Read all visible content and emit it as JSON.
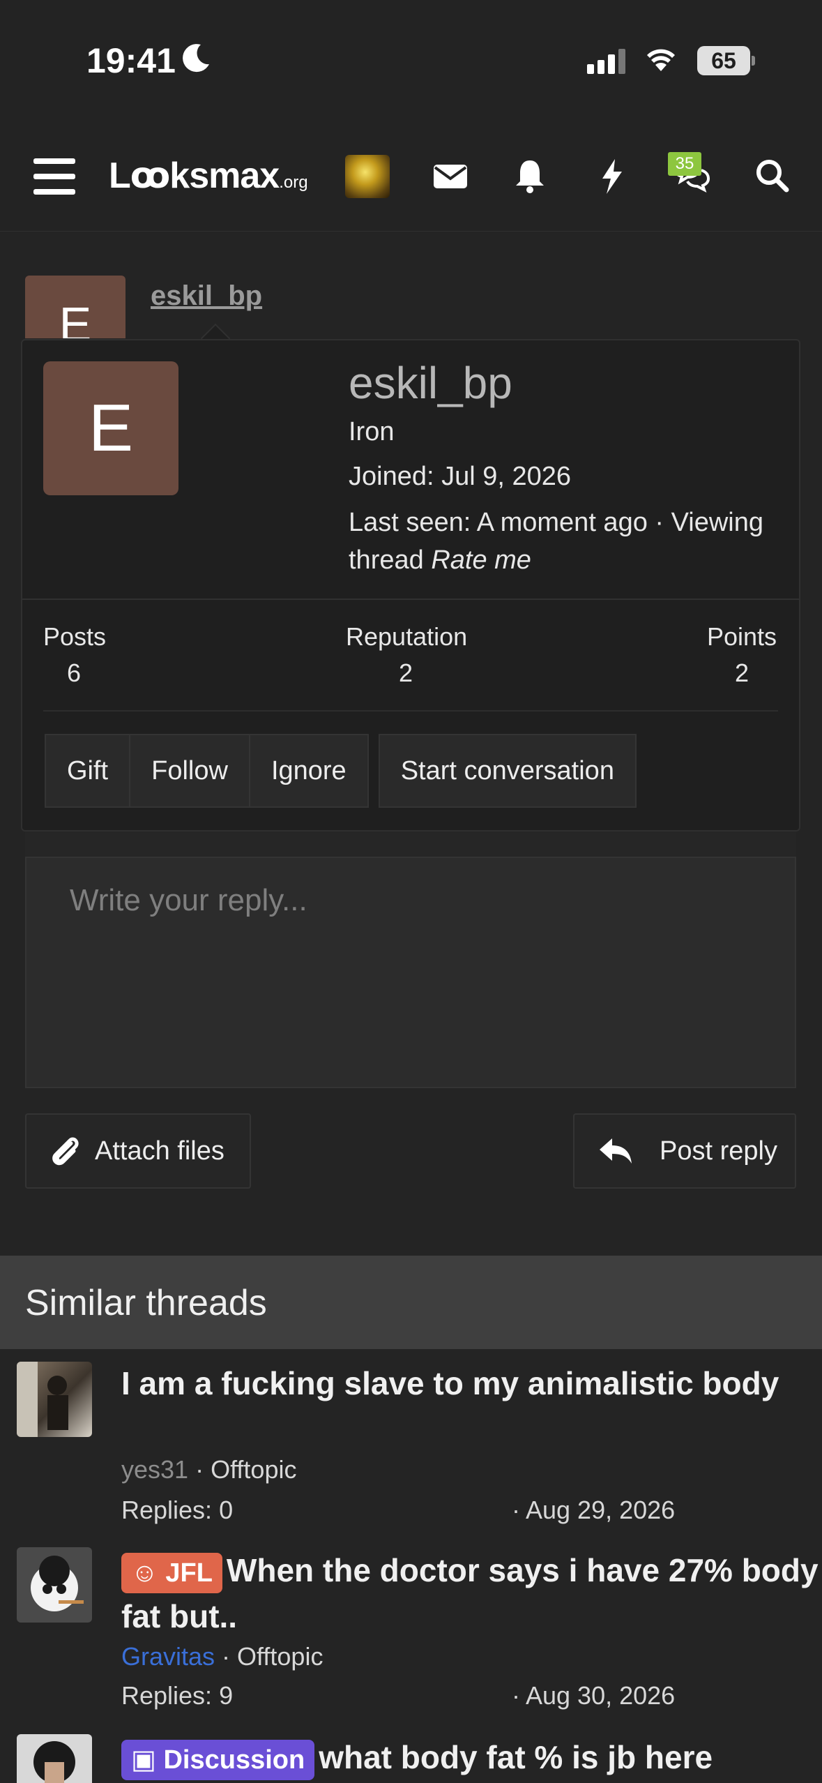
{
  "status_bar": {
    "time": "19:41",
    "battery": "65"
  },
  "nav": {
    "logo_main": "Lꝏksmax",
    "logo_suffix": ".org",
    "notification_badge": "35"
  },
  "post": {
    "avatar_letter": "E",
    "username": "eskil_bp"
  },
  "profile_popup": {
    "avatar_letter": "E",
    "username": "eskil_bp",
    "rank": "Iron",
    "joined": "Joined: Jul 9, 2026",
    "last_seen_prefix": "Last seen: A moment ago · Viewing thread ",
    "last_seen_thread": "Rate me",
    "stats": [
      {
        "label": "Posts",
        "value": "6"
      },
      {
        "label": "Reputation",
        "value": "2"
      },
      {
        "label": "Points",
        "value": "2"
      }
    ],
    "buttons": [
      "Gift",
      "Follow",
      "Ignore",
      "Start conversation"
    ]
  },
  "reply": {
    "placeholder": "Write your reply...",
    "attach_label": "Attach files",
    "post_label": "Post reply"
  },
  "similar_threads": {
    "title": "Similar threads",
    "threads": [
      {
        "prefix": "",
        "title": "I am a fucking slave to my animalistic body",
        "user": "yes31",
        "forum": " · Offtopic",
        "replies": "Replies: 0",
        "date": "· Aug 29, 2026"
      },
      {
        "prefix": "JFL",
        "title": "When the doctor says i have 27% body fat but..",
        "user": "Gravitas",
        "forum": " · Offtopic",
        "replies": "Replies: 9",
        "date": "· Aug 30, 2026"
      },
      {
        "prefix": "Discussion",
        "title": "what body fat % is jb here",
        "user": "",
        "forum": "",
        "replies": "",
        "date": ""
      }
    ]
  },
  "colors": {
    "background": "#242424",
    "avatar_brown": "#6a4a3f",
    "jfl_prefix": "#e0664a",
    "discussion_prefix": "#6a4fd6",
    "badge_green": "#8dc63f",
    "user_blue": "#3a6fd8"
  }
}
